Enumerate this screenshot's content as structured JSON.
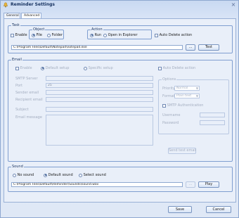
{
  "window": {
    "title": "Reminder Settings"
  },
  "tabs": [
    {
      "label": "General"
    },
    {
      "label": "Advanced"
    }
  ],
  "task": {
    "legend": "Task",
    "enable_label": "Enable",
    "object_legend": "Object",
    "object_options": [
      {
        "label": "File",
        "selected": true
      },
      {
        "label": "Folder",
        "selected": false
      }
    ],
    "action_legend": "Action",
    "action_options": [
      {
        "label": "Run",
        "selected": true
      },
      {
        "label": "Open in Explorer",
        "selected": false
      }
    ],
    "auto_delete_label": "Auto Delete action",
    "path_value": "C:\\Program Files\\Default\\Notepad\\notepad.exe",
    "browse_label": "...",
    "test_label": "Test"
  },
  "email": {
    "legend": "Email",
    "enable_label": "Enable",
    "default_setup_label": "Default setup",
    "specific_setup_label": "Specific setup",
    "auto_delete_label": "Auto Delete action",
    "smtp_server_label": "SMTP Server",
    "port_label": "Port",
    "port_value": "25",
    "sender_email_label": "Sender email",
    "recipient_label": "Recipient email",
    "subject_label": "Subject",
    "email_message_label": "Email message",
    "options": {
      "legend": "Options",
      "priority_label": "Priority",
      "priority_value": "Normal",
      "format_label": "Format",
      "format_value": "Plain text",
      "smtp_auth_label": "SMTP Authentication",
      "username_label": "Username",
      "password_label": "Password"
    },
    "send_test_label": "Send test email"
  },
  "sound": {
    "legend": "Sound",
    "options": [
      {
        "label": "No sound",
        "selected": false
      },
      {
        "label": "Default sound",
        "selected": true
      },
      {
        "label": "Select sound",
        "selected": false
      }
    ],
    "path_value": "C:\\Program Files\\Default\\Reminder\\Sounds\\sound.wav",
    "browse_label": "...",
    "play_label": "Play"
  },
  "footer": {
    "save_label": "Save",
    "cancel_label": "Cancel"
  }
}
